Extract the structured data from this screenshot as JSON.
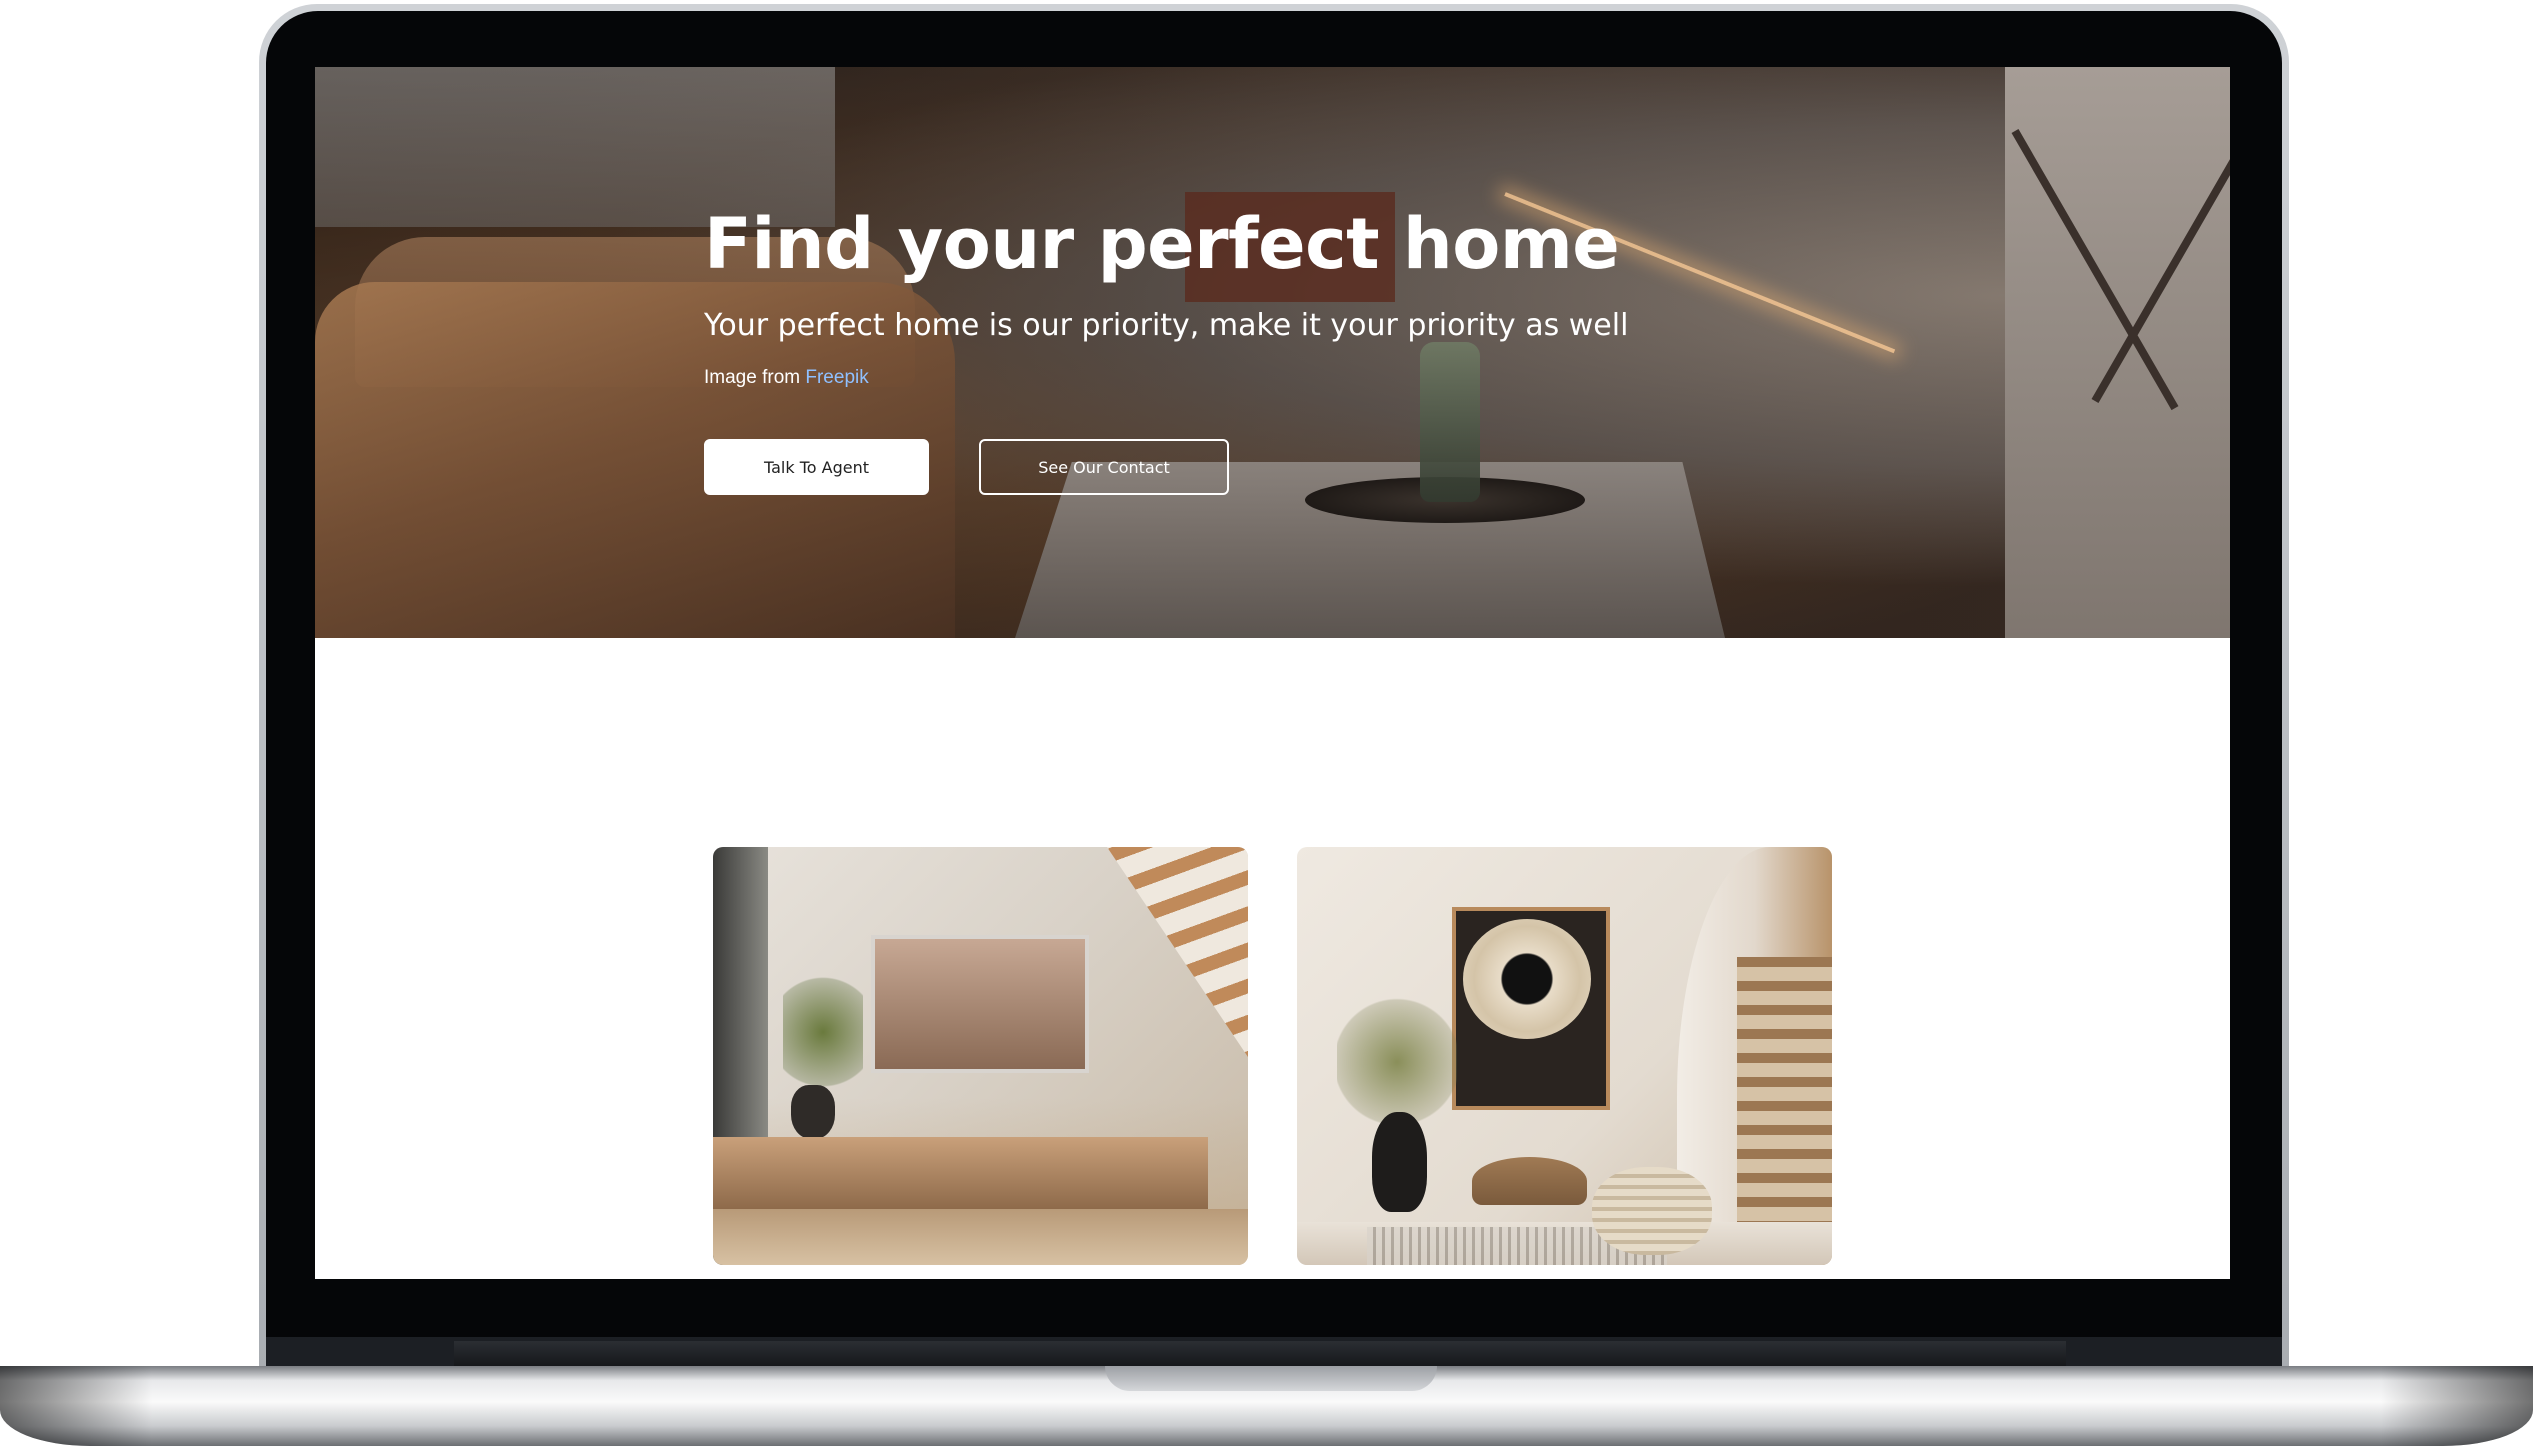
{
  "hero": {
    "title": "Find your perfect home",
    "subtitle": "Your perfect home is our priority, make it your priority as well",
    "credit_prefix": "Image from ",
    "credit_link": "Freepik",
    "buttons": {
      "primary": "Talk To Agent",
      "secondary": "See Our Contact"
    }
  },
  "colors": {
    "link": "#8fc0ff",
    "button_primary_bg": "#ffffff",
    "button_outline_border": "#ffffff"
  },
  "gallery": {
    "cards": [
      {
        "image": "living-room-with-staircase-image"
      },
      {
        "image": "hallway-with-spiral-staircase-image"
      }
    ]
  }
}
